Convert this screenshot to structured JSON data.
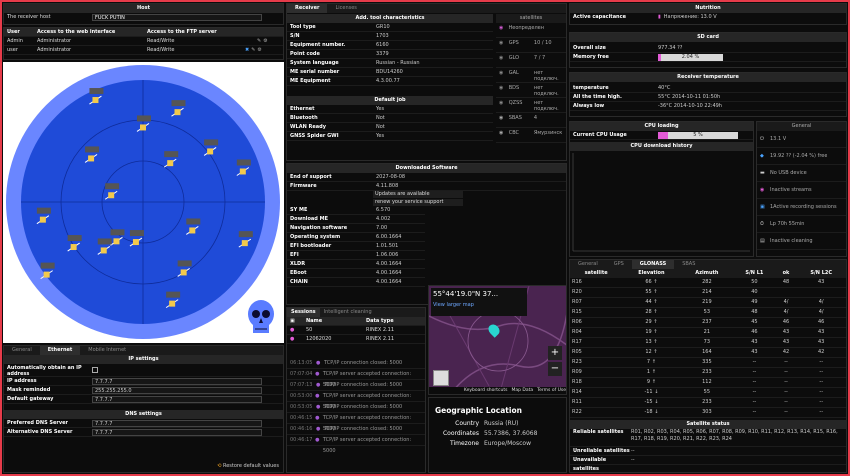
{
  "colors": {
    "accent": "#e63b4a",
    "sky": "#1f4bd8",
    "skyOuter": "#6a86ff",
    "pink": "#e25bd6"
  },
  "host": {
    "header": "Host",
    "label": "The receiver host",
    "value": "FUCK PUTIN"
  },
  "users": {
    "headers": [
      "User",
      "Access to the web interface",
      "Access to the FTP server"
    ],
    "rows": [
      {
        "user": "Admin",
        "web": "Administrator",
        "ftp": "Read/Write"
      },
      {
        "user": "user",
        "web": "Administrator",
        "ftp": "Read/Write"
      }
    ]
  },
  "network": {
    "tabs": [
      "General",
      "Ethernet",
      "Mobile Internet"
    ],
    "ip_header": "IP settings",
    "auto_label": "Automatically obtain an IP address",
    "fields": [
      {
        "label": "IP address",
        "value": "7.7.7.7"
      },
      {
        "label": "Mask reminded",
        "value": "255.255.255.0"
      },
      {
        "label": "Default gateway",
        "value": "7.7.7.7"
      }
    ],
    "dns_header": "DNS settings",
    "dns": [
      {
        "label": "Preferred DNS Server",
        "value": "7.7.7.7"
      },
      {
        "label": "Alternative DNS Server",
        "value": "7.7.7.7"
      }
    ],
    "restore": "Restore default values"
  },
  "receiver": {
    "tabs": [
      "Receiver",
      "Licenses"
    ],
    "char_header": "Add. tool characteristics",
    "chars": [
      {
        "k": "Tool type",
        "v": "GR10"
      },
      {
        "k": "S/N",
        "v": "1703"
      },
      {
        "k": "Equipment number.",
        "v": "6160"
      },
      {
        "k": "Point code",
        "v": "3379"
      },
      {
        "k": "System language",
        "v": "Russian - Russian"
      },
      {
        "k": "ME serial number",
        "v": "BDU14260"
      },
      {
        "k": "ME Equipment",
        "v": "4.3.00.77"
      }
    ],
    "sat_header": "satellites",
    "sats": [
      {
        "name": "Неопределен",
        "v": ""
      },
      {
        "name": "GPS",
        "v": "10 / 10"
      },
      {
        "name": "GLO",
        "v": "7 / 7"
      },
      {
        "name": "GAL",
        "v": "нет подключ."
      },
      {
        "name": "BDS",
        "v": "нет подключ."
      },
      {
        "name": "QZSS",
        "v": "нет подключ."
      },
      {
        "name": "SBAS",
        "v": "4"
      },
      {
        "name": "CBC",
        "v": "Ямурзинск"
      }
    ],
    "job_header": "Default job",
    "jobs": [
      {
        "k": "Ethernet",
        "v": "Yes"
      },
      {
        "k": "Bluetooth",
        "v": "Not"
      },
      {
        "k": "WLAN Ready",
        "v": "Not"
      },
      {
        "k": "GNSS Spider GWI",
        "v": "Yes"
      }
    ],
    "sw_header": "Downloaded Software",
    "sw": [
      {
        "k": "End of support",
        "v": "2027-08-08"
      },
      {
        "k": "Firmware",
        "v": "4.11.808"
      }
    ],
    "update1": "Updates are available",
    "update2": "renew your service support",
    "sw2": [
      {
        "k": "SY ME",
        "v": "6.570"
      },
      {
        "k": "Download ME",
        "v": "4.002"
      },
      {
        "k": "Navigation software",
        "v": "7.00"
      },
      {
        "k": "Operating system",
        "v": "6.00.1664"
      },
      {
        "k": "EFI bootloader",
        "v": "1.01.501"
      },
      {
        "k": "EFI",
        "v": "1.06.006"
      },
      {
        "k": "XLDR",
        "v": "4.00.1664"
      },
      {
        "k": "EBoot",
        "v": "4.00.1664"
      },
      {
        "k": "CHAIN",
        "v": "4.00.1664"
      }
    ],
    "sess_tabs": [
      "Sessions",
      "Intelligent cleaning"
    ],
    "sess_headers": [
      "Name",
      "Data type"
    ],
    "sessions": [
      {
        "name": "50",
        "type": "RINEX 2.11"
      },
      {
        "name": "12062020",
        "type": "RINEX 2.11"
      }
    ],
    "log": [
      {
        "t": "06:13:05",
        "m": "TCP/IP connection closed: 5000"
      },
      {
        "t": "07:07:04",
        "m": "TCP/IP server accepted connection: 5000"
      },
      {
        "t": "07:07:13",
        "m": "TCP/IP connection closed: 5000"
      },
      {
        "t": "00:53:00",
        "m": "TCP/IP server accepted connection: 5000"
      },
      {
        "t": "00:53:05",
        "m": "TCP/IP connection closed: 5000"
      },
      {
        "t": "00:46:15",
        "m": "TCP/IP server accepted connection: 5000"
      },
      {
        "t": "00:46:16",
        "m": "TCP/IP connection closed: 5000"
      },
      {
        "t": "00:46:17",
        "m": "TCP/IP server accepted connection: 5000"
      }
    ]
  },
  "map": {
    "coords": "55°44'19.0\"N 37...",
    "larger": "View larger map",
    "footer": [
      "Keyboard shortcuts",
      "Map Data",
      "Terms of Use"
    ],
    "geo_title": "Geographic Location",
    "geo": [
      {
        "k": "Country",
        "v": "Russia (RU)"
      },
      {
        "k": "Coordinates",
        "v": "55.7386, 37.6068"
      },
      {
        "k": "Timezone",
        "v": "Europe/Moscow"
      }
    ]
  },
  "status": {
    "nutrition_header": "Nutrition",
    "nutrition_label": "Active capacitance",
    "nutrition_value": "Напряжение: 13.0 V",
    "sd_header": "SD card",
    "sd": [
      {
        "k": "Overall size",
        "v": "977.34 ??"
      },
      {
        "k": "Memory free",
        "v": "2.04 %"
      }
    ],
    "sd_free_fraction": 0.0204,
    "temp_header": "Receiver temperature",
    "temp": [
      {
        "k": "temperature",
        "v": "40°C"
      },
      {
        "k": "All the time high.",
        "v": "55°C 2014-10-11 01:50h"
      },
      {
        "k": "Always low",
        "v": "-36°C 2014-10-10 22:49h"
      }
    ],
    "cpu_header": "CPU loading",
    "cpu_label": "Current CPU Usage",
    "cpu_value": "5 %",
    "cpu_fraction": 0.05,
    "cpu_hist_header": "CPU download history",
    "general_header": "General",
    "general": [
      "13.1 V",
      "19.92 ?? (-2.04 %) free",
      "No USB device",
      "Inactive streams",
      "1Active recording sessions",
      "Lp 70h 55min",
      "Inactive cleaning"
    ]
  },
  "sattable": {
    "tabs": [
      "General",
      "GPS",
      "GLONASS",
      "SBAS"
    ],
    "headers": [
      "satellite",
      "Elevation",
      "Azimuth",
      "S/N L1",
      "ok",
      "S/N L2C"
    ],
    "rows": [
      [
        "R16",
        "66 ↑",
        "282",
        "50",
        "48",
        "43"
      ],
      [
        "R20",
        "55 ↑",
        "214",
        "40",
        "",
        ""
      ],
      [
        "R07",
        "44 ↑",
        "219",
        "49",
        "4/",
        "4/"
      ],
      [
        "R15",
        "28 ↑",
        "53",
        "48",
        "4/",
        "4/"
      ],
      [
        "R06",
        "29 ↑",
        "237",
        "45",
        "46",
        "46"
      ],
      [
        "R04",
        "19 ↑",
        "21",
        "46",
        "43",
        "43"
      ],
      [
        "R17",
        "13 ↑",
        "73",
        "43",
        "43",
        "43"
      ],
      [
        "R05",
        "12 ↑",
        "164",
        "43",
        "42",
        "42"
      ],
      [
        "R23",
        "7 ↑",
        "335",
        "--",
        "--",
        "--"
      ],
      [
        "R09",
        "1 ↑",
        "233",
        "--",
        "--",
        "--"
      ],
      [
        "R18",
        "9 ↑",
        "112",
        "--",
        "--",
        "--"
      ],
      [
        "R14",
        "-11 ↓",
        "55",
        "--",
        "--",
        "--"
      ],
      [
        "R11",
        "-15 ↓",
        "233",
        "--",
        "--",
        "--"
      ],
      [
        "R22",
        "-18 ↓",
        "303",
        "--",
        "--",
        "--"
      ]
    ],
    "status_header": "Satellite status",
    "reliable_label": "Reliable satellites",
    "reliable_value": "R01, R02, R03, R04, R05, R06, R07, R08, R09, R10, R11, R12, R13, R14, R15, R16, R17, R18, R19, R20, R21, R22, R23, R24",
    "unreliable_label": "Unreliable satellites",
    "unreliable_value": "--",
    "unavail_label": "Unavailable satellites",
    "unavail_value": "--"
  },
  "skyplot": {
    "sats": [
      {
        "az": 282,
        "el": 66
      },
      {
        "az": 214,
        "el": 55
      },
      {
        "az": 219,
        "el": 44
      },
      {
        "az": 53,
        "el": 28
      },
      {
        "az": 237,
        "el": 29
      },
      {
        "az": 21,
        "el": 19
      },
      {
        "az": 73,
        "el": 13
      },
      {
        "az": 164,
        "el": 12
      },
      {
        "az": 335,
        "el": 7
      },
      {
        "az": 233,
        "el": 1
      },
      {
        "az": 112,
        "el": 9
      },
      {
        "az": 310,
        "el": 40
      },
      {
        "az": 120,
        "el": 48
      },
      {
        "az": 150,
        "el": 30
      },
      {
        "az": 190,
        "el": 60
      },
      {
        "az": 35,
        "el": 55
      },
      {
        "az": 0,
        "el": 35
      },
      {
        "az": 260,
        "el": 15
      }
    ]
  }
}
